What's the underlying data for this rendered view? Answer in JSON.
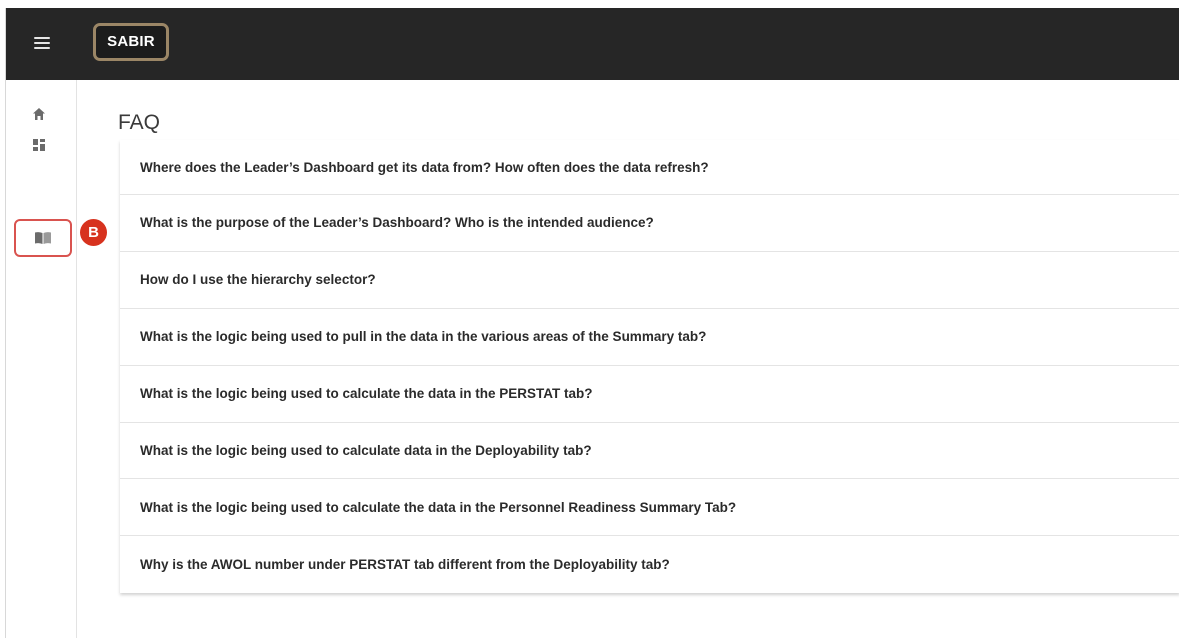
{
  "header": {
    "logo_text": "SABIR"
  },
  "sidebar": {
    "items": [
      {
        "icon": "home-icon"
      },
      {
        "icon": "dashboard-icon"
      },
      {
        "icon": "book-icon",
        "highlighted": true
      }
    ]
  },
  "callout": {
    "label": "B",
    "color": "#d7321e"
  },
  "main": {
    "title": "FAQ",
    "faq": [
      "Where does the Leader’s Dashboard get its data from? How often does the data refresh?",
      "What is the purpose of the Leader’s Dashboard? Who is the intended audience?",
      "How do I use the hierarchy selector?",
      "What is the logic being used to pull in the data in the various areas of the Summary tab?",
      "What is the logic being used to calculate the data in the PERSTAT tab?",
      "What is the logic being used to calculate data in the Deployability tab?",
      "What is the logic being used to calculate the data in the Personnel Readiness Summary Tab?",
      "Why is the AWOL number under PERSTAT tab different from the Deployability tab?"
    ]
  },
  "colors": {
    "topbar": "#262626",
    "logo_border": "#9b8666",
    "highlight": "#d9534f"
  }
}
